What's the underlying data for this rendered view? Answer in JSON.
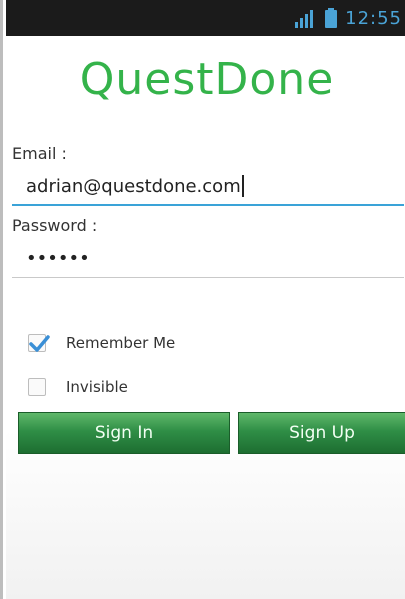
{
  "status_bar": {
    "time": "12:55",
    "signal_icon": "signal-icon",
    "battery_icon": "battery-icon"
  },
  "app": {
    "title": "QuestDone"
  },
  "form": {
    "email_label": "Email :",
    "email_value": "adrian@questdone.com",
    "password_label": "Password :",
    "password_value": "••••••",
    "remember_label": "Remember Me",
    "remember_checked": true,
    "invisible_label": "Invisible",
    "invisible_checked": false
  },
  "buttons": {
    "sign_in": "Sign In",
    "sign_up": "Sign Up"
  },
  "colors": {
    "title": "#34b34a",
    "button_green": "#2f8e46",
    "accent_blue": "#3aa3d8",
    "checkmark_blue": "#3a8fd6"
  }
}
